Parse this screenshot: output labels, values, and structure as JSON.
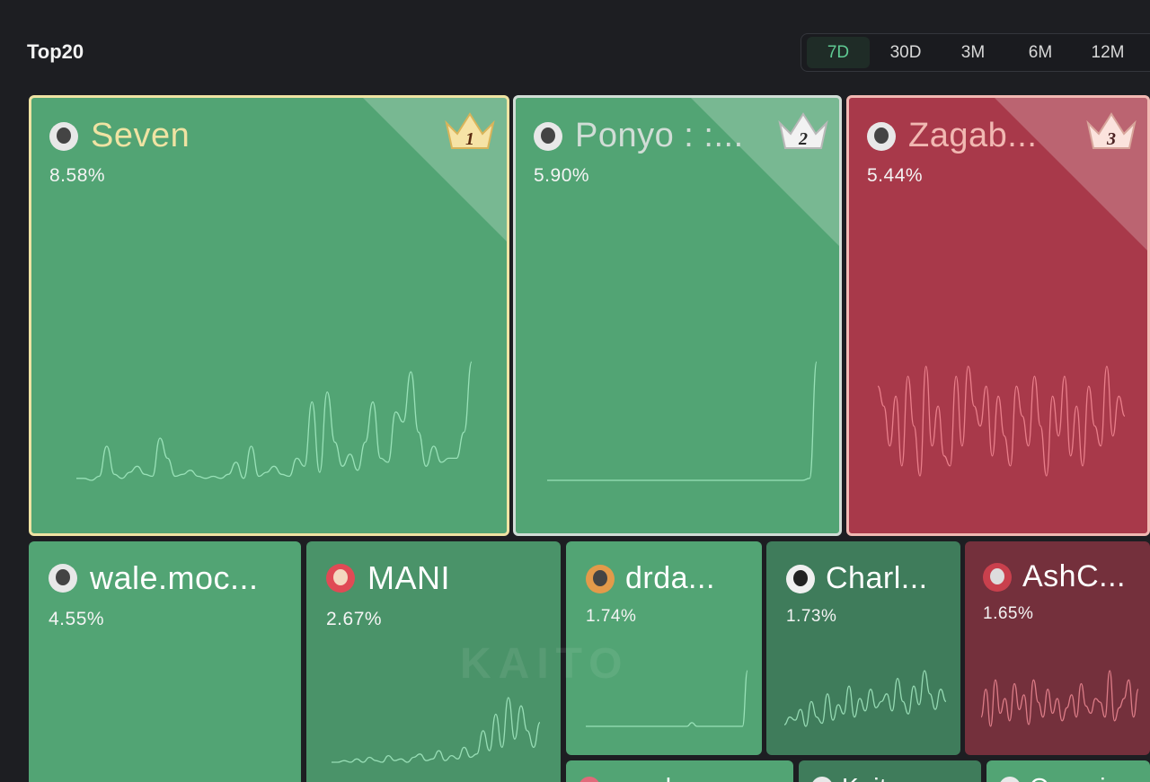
{
  "header": {
    "title": "Top20"
  },
  "periods": [
    {
      "label": "7D",
      "active": true
    },
    {
      "label": "30D",
      "active": false
    },
    {
      "label": "3M",
      "active": false
    },
    {
      "label": "6M",
      "active": false
    },
    {
      "label": "12M",
      "active": false
    }
  ],
  "colors": {
    "up": "#52a474",
    "up_dark": "#3f7c5b",
    "up_mid": "#4a9369",
    "down": "#a8394a",
    "down_dark": "#74303c",
    "gold": "#efe3a3",
    "silver": "#d1ddd6",
    "bronze": "#f1b8b2"
  },
  "tiles": [
    {
      "name": "Seven",
      "pct": "8.58%",
      "rank": "1",
      "trend": "up",
      "spark": [
        2,
        2,
        1,
        3,
        18,
        4,
        2,
        5,
        8,
        4,
        3,
        22,
        12,
        3,
        4,
        6,
        3,
        2,
        3,
        2,
        4,
        10,
        2,
        18,
        3,
        5,
        8,
        4,
        3,
        12,
        8,
        40,
        5,
        45,
        20,
        8,
        14,
        6,
        20,
        40,
        12,
        10,
        35,
        30,
        55,
        25,
        8,
        18,
        10,
        12,
        12,
        25,
        60
      ]
    },
    {
      "name": "Ponyo : :...",
      "pct": "5.90%",
      "rank": "2",
      "trend": "up",
      "spark": [
        0,
        0,
        0,
        0,
        0,
        0,
        0,
        0,
        0,
        0,
        0,
        0,
        0,
        0,
        0,
        0,
        0,
        0,
        0,
        0,
        0,
        0,
        0,
        0,
        0,
        0,
        0,
        0,
        0,
        0,
        0,
        0,
        0,
        0,
        0,
        0,
        0,
        1,
        60
      ]
    },
    {
      "name": "Zagab...",
      "pct": "5.44%",
      "rank": "3",
      "trend": "down",
      "spark": [
        50,
        40,
        20,
        45,
        10,
        55,
        30,
        5,
        60,
        20,
        40,
        15,
        10,
        55,
        20,
        60,
        40,
        30,
        50,
        15,
        45,
        25,
        10,
        50,
        35,
        20,
        55,
        30,
        5,
        45,
        25,
        55,
        15,
        40,
        10,
        50,
        30,
        20,
        60,
        25,
        45,
        35
      ]
    },
    {
      "name": "wale.moc...",
      "pct": "4.55%",
      "trend": "up",
      "spark": []
    },
    {
      "name": "MANI",
      "pct": "2.67%",
      "trend": "up",
      "spark": [
        1,
        1,
        2,
        1,
        3,
        1,
        4,
        2,
        1,
        5,
        2,
        3,
        1,
        4,
        6,
        2,
        3,
        8,
        2,
        5,
        3,
        10,
        4,
        6,
        20,
        8,
        30,
        10,
        40,
        15,
        35,
        20,
        10,
        25
      ]
    },
    {
      "name": "drda...",
      "pct": "1.74%",
      "trend": "up",
      "spark": [
        0,
        0,
        0,
        0,
        0,
        0,
        0,
        0,
        0,
        0,
        0,
        0,
        0,
        0,
        0,
        0,
        0,
        0,
        0,
        0,
        0,
        2,
        0,
        0,
        0,
        0,
        0,
        0,
        0,
        0,
        0,
        0,
        30
      ]
    },
    {
      "name": "Charl...",
      "pct": "1.73%",
      "trend": "up",
      "spark": [
        5,
        10,
        8,
        15,
        4,
        20,
        10,
        6,
        25,
        8,
        18,
        12,
        30,
        10,
        22,
        14,
        28,
        16,
        20,
        25,
        14,
        35,
        20,
        12,
        30,
        18,
        40,
        25,
        15,
        28,
        20
      ]
    },
    {
      "name": "AshC...",
      "pct": "1.65%",
      "trend": "down",
      "spark": [
        10,
        25,
        5,
        30,
        12,
        20,
        8,
        28,
        14,
        22,
        6,
        30,
        18,
        10,
        25,
        12,
        20,
        8,
        15,
        22,
        10,
        28,
        16,
        12,
        20,
        18,
        10,
        35,
        8,
        15,
        20,
        30,
        10,
        25
      ]
    },
    {
      "name": "peachy...",
      "trend": "up"
    },
    {
      "name": "Kait...",
      "trend": "up"
    },
    {
      "name": "Onomi...",
      "trend": "up"
    }
  ],
  "watermark": "KAITO"
}
